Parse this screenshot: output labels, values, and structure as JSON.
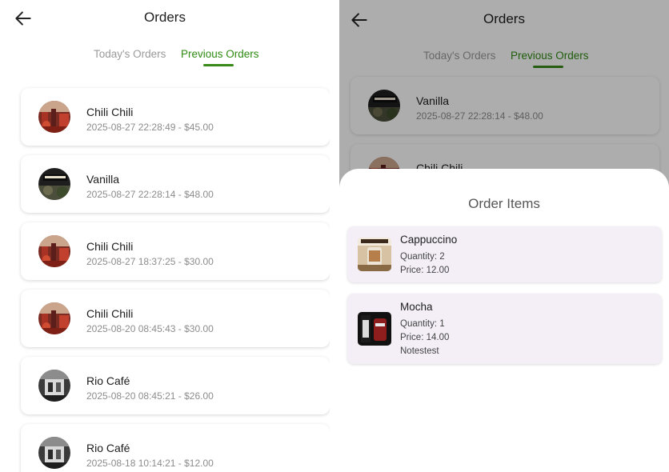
{
  "left_screen": {
    "appbar": {
      "title": "Orders"
    },
    "tabs": {
      "today": "Today's Orders",
      "previous": "Previous Orders",
      "active": "previous"
    },
    "orders": [
      {
        "name": "Chili Chili",
        "detail": "2025-08-27 22:28:49 - $45.00",
        "image": "chili-chili-thumb"
      },
      {
        "name": "Vanilla",
        "detail": "2025-08-27 22:28:14 - $48.00",
        "image": "vanilla-thumb"
      },
      {
        "name": "Chili Chili",
        "detail": "2025-08-27 18:37:25 - $30.00",
        "image": "chili-chili-thumb"
      },
      {
        "name": "Chili Chili",
        "detail": "2025-08-20 08:45:43 - $30.00",
        "image": "chili-chili-thumb"
      },
      {
        "name": "Rio Café",
        "detail": "2025-08-20 08:45:21 - $26.00",
        "image": "rio-cafe-thumb"
      },
      {
        "name": "Rio Café",
        "detail": "2025-08-18 10:14:21 - $12.00",
        "image": "rio-cafe-thumb"
      }
    ]
  },
  "right_screen": {
    "appbar": {
      "title": "Orders"
    },
    "tabs": {
      "today": "Today's Orders",
      "previous": "Previous Orders",
      "active": "previous"
    },
    "orders": [
      {
        "name": "Vanilla",
        "detail": "2025-08-27 22:28:14 - $48.00",
        "image": "vanilla-thumb"
      },
      {
        "name": "Chili Chili",
        "detail": ""
      }
    ],
    "sheet": {
      "title": "Order Items",
      "items": [
        {
          "name": "Cappuccino",
          "quantity": "Quantity: 2",
          "price": "Price: 12.00",
          "notes": "",
          "image": "cappuccino-thumb"
        },
        {
          "name": "Mocha",
          "quantity": "Quantity: 1",
          "price": "Price: 14.00",
          "notes": "Notestest",
          "image": "mocha-thumb"
        }
      ]
    }
  },
  "colors": {
    "accent_green": "#2f8a12",
    "tab_inactive": "#9a9a9a",
    "sheet_item_bg": "#f4eff7",
    "scrim": "rgba(0,0,0,0.32)"
  },
  "icons": {
    "back": "arrow-left-icon"
  }
}
